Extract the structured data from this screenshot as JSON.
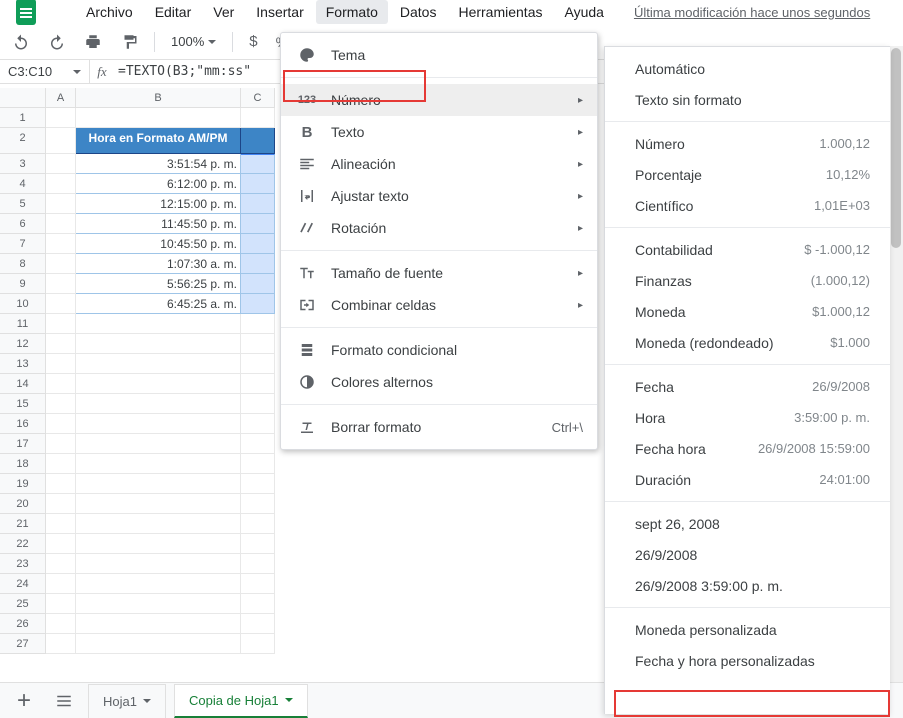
{
  "menus": {
    "file": "Archivo",
    "edit": "Editar",
    "view": "Ver",
    "insert": "Insertar",
    "format": "Formato",
    "data": "Datos",
    "tools": "Herramientas",
    "help": "Ayuda"
  },
  "last_mod": "Última modificación hace unos segundos",
  "toolbar": {
    "zoom": "100%",
    "currency": "$",
    "percent": "%"
  },
  "namebox": "C3:C10",
  "formula": "=TEXTO(B3;\"mm:ss\"",
  "cols": [
    "A",
    "B",
    "C"
  ],
  "row_labels": [
    "1",
    "2",
    "3",
    "4",
    "5",
    "6",
    "7",
    "8",
    "9",
    "10",
    "11",
    "12",
    "13",
    "14",
    "15",
    "16",
    "17",
    "18",
    "19",
    "20",
    "21",
    "22",
    "23",
    "24",
    "25",
    "26",
    "27"
  ],
  "cell_header": "Hora en Formato AM/PM",
  "cell_data": [
    "3:51:54 p. m.",
    "6:12:00 p. m.",
    "12:15:00 p. m.",
    "11:45:50 p. m.",
    "10:45:50 p. m.",
    "1:07:30 a. m.",
    "5:56:25 p. m.",
    "6:45:25 a. m."
  ],
  "fmtmenu": {
    "theme": "Tema",
    "number": "Número",
    "text": "Texto",
    "align": "Alineación",
    "wrap": "Ajustar texto",
    "rotate": "Rotación",
    "fontsize": "Tamaño de fuente",
    "merge": "Combinar celdas",
    "condf": "Formato condicional",
    "altcolors": "Colores alternos",
    "clear": "Borrar formato",
    "clear_sc": "Ctrl+\\"
  },
  "nummenu": {
    "auto": "Automático",
    "plain": "Texto sin formato",
    "number": {
      "l": "Número",
      "e": "1.000,12"
    },
    "percent": {
      "l": "Porcentaje",
      "e": "10,12%"
    },
    "sci": {
      "l": "Científico",
      "e": "1,01E+03"
    },
    "account": {
      "l": "Contabilidad",
      "e": "$ -1.000,12"
    },
    "finance": {
      "l": "Finanzas",
      "e": "(1.000,12)"
    },
    "currency": {
      "l": "Moneda",
      "e": "$1.000,12"
    },
    "currencyr": {
      "l": "Moneda (redondeado)",
      "e": "$1.000"
    },
    "date": {
      "l": "Fecha",
      "e": "26/9/2008"
    },
    "time": {
      "l": "Hora",
      "e": "3:59:00 p. m."
    },
    "datetime": {
      "l": "Fecha hora",
      "e": "26/9/2008 15:59:00"
    },
    "duration": {
      "l": "Duración",
      "e": "24:01:00"
    },
    "ex1": "sept 26, 2008",
    "ex2": "26/9/2008",
    "ex3": "26/9/2008 3:59:00 p. m.",
    "customcur": "Moneda personalizada",
    "customdt": "Fecha y hora personalizadas"
  },
  "sheets": {
    "s1": "Hoja1",
    "s2": "Copia de Hoja1"
  }
}
